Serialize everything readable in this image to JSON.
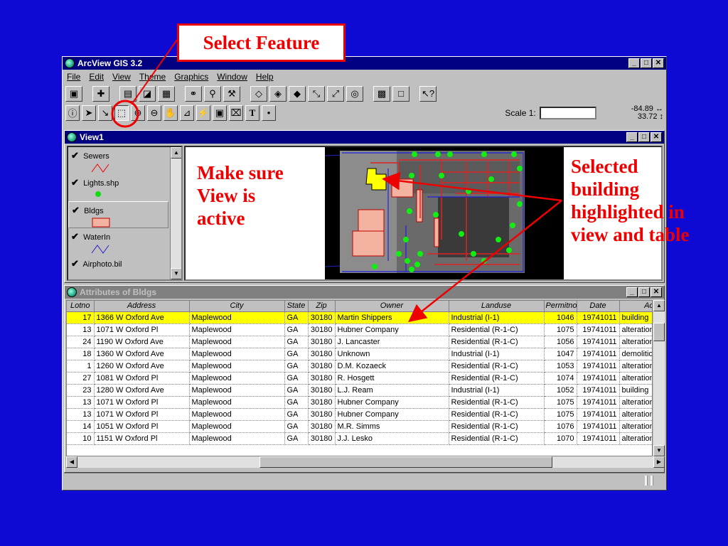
{
  "callouts": {
    "select_feature": "Select Feature",
    "make_sure": [
      "Make sure",
      "View is",
      "active"
    ],
    "selected": [
      "Selected",
      "building",
      "highlighted in",
      "view and table"
    ]
  },
  "app": {
    "title": "ArcView GIS 3.2",
    "menu": [
      "File",
      "Edit",
      "View",
      "Theme",
      "Graphics",
      "Window",
      "Help"
    ],
    "scale_label": "Scale 1:",
    "scale_value": "",
    "coord_x": "-84.89",
    "coord_y": "33.72"
  },
  "view": {
    "title": "View1",
    "themes": [
      {
        "name": "Sewers",
        "symbol": "line",
        "checked": true,
        "active": false
      },
      {
        "name": "Lights.shp",
        "symbol": "point",
        "checked": true,
        "active": false
      },
      {
        "name": "Bldgs",
        "symbol": "fill",
        "checked": true,
        "active": true
      },
      {
        "name": "WaterIn",
        "symbol": "line-blue",
        "checked": true,
        "active": false
      },
      {
        "name": "Airphoto.bil",
        "symbol": "none",
        "checked": true,
        "active": false
      }
    ]
  },
  "attributes": {
    "title": "Attributes of Bldgs",
    "columns": [
      "Lotno",
      "Address",
      "City",
      "State",
      "Zip",
      "Owner",
      "Landuse",
      "Permitno",
      "Date",
      "Ac"
    ],
    "rows": [
      [
        "17",
        "1366 W Oxford Ave",
        "Maplewood",
        "GA",
        "30180",
        "Martin Shippers",
        "Industrial (I-1)",
        "1046",
        "19741011",
        "building"
      ],
      [
        "13",
        "1071 W Oxford Pl",
        "Maplewood",
        "GA",
        "30180",
        "Hubner Company",
        "Residential (R-1-C)",
        "1075",
        "19741011",
        "alteration"
      ],
      [
        "24",
        "1190 W Oxford Ave",
        "Maplewood",
        "GA",
        "30180",
        "J. Lancaster",
        "Residential (R-1-C)",
        "1056",
        "19741011",
        "alteration"
      ],
      [
        "18",
        "1360 W Oxford Ave",
        "Maplewood",
        "GA",
        "30180",
        "Unknown",
        "Industrial (I-1)",
        "1047",
        "19741011",
        "demolition"
      ],
      [
        "1",
        "1260 W Oxford Ave",
        "Maplewood",
        "GA",
        "30180",
        "D.M. Kozaeck",
        "Residential (R-1-C)",
        "1053",
        "19741011",
        "alteration"
      ],
      [
        "27",
        "1081 W Oxford Pl",
        "Maplewood",
        "GA",
        "30180",
        "R. Hosgett",
        "Residential (R-1-C)",
        "1074",
        "19741011",
        "alteration"
      ],
      [
        "23",
        "1280 W Oxford Ave",
        "Maplewood",
        "GA",
        "30180",
        "L.J. Ream",
        "Industrial (I-1)",
        "1052",
        "19741011",
        "building"
      ],
      [
        "13",
        "1071 W Oxford Pl",
        "Maplewood",
        "GA",
        "30180",
        "Hubner Company",
        "Residential (R-1-C)",
        "1075",
        "19741011",
        "alteration"
      ],
      [
        "13",
        "1071 W Oxford Pl",
        "Maplewood",
        "GA",
        "30180",
        "Hubner Company",
        "Residential (R-1-C)",
        "1075",
        "19741011",
        "alteration"
      ],
      [
        "14",
        "1051 W Oxford Pl",
        "Maplewood",
        "GA",
        "30180",
        "M.R. Simms",
        "Residential (R-1-C)",
        "1076",
        "19741011",
        "alteration"
      ],
      [
        "10",
        "1151 W Oxford Pl",
        "Maplewood",
        "GA",
        "30180",
        "J.J. Lesko",
        "Residential (R-1-C)",
        "1070",
        "19741011",
        "alteration"
      ]
    ],
    "selected_row": 0
  },
  "colors": {
    "desktop": "#0e0ad4",
    "callout": "#ee0000",
    "selection": "#ffff00",
    "titlebar": "#000080"
  }
}
